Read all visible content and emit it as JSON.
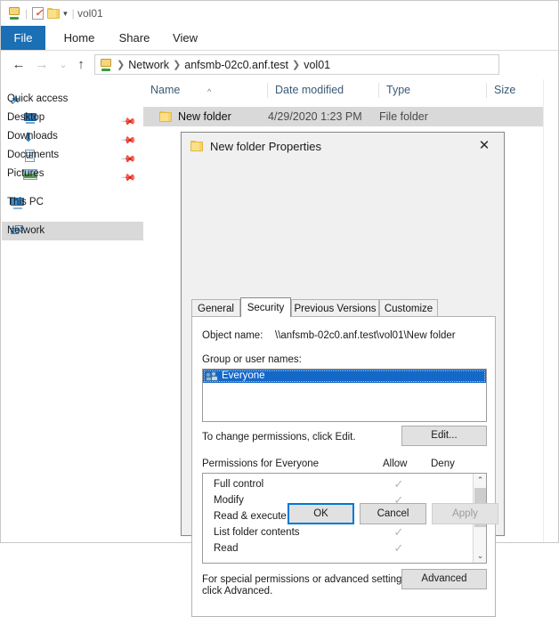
{
  "window": {
    "title": "vol01",
    "quick_access_toolbar": [
      {
        "name": "network-drive-icon",
        "glyph": "netdrive"
      },
      {
        "name": "properties-icon",
        "glyph": "props"
      },
      {
        "name": "new-folder-icon",
        "glyph": "folder"
      },
      {
        "name": "customize-qat-caret",
        "glyph": "caret"
      }
    ],
    "ribbon_tabs": [
      {
        "label": "File",
        "active": true
      },
      {
        "label": "Home",
        "active": false
      },
      {
        "label": "Share",
        "active": false
      },
      {
        "label": "View",
        "active": false
      }
    ],
    "nav_buttons": {
      "back": "←",
      "forward": "→",
      "recent": "⌄",
      "up": "↑"
    },
    "breadcrumb": [
      "Network",
      "anfsmb-02c0.anf.test",
      "vol01"
    ]
  },
  "sidebar": {
    "items": [
      {
        "label": "Quick access",
        "icon": "star-icon",
        "pinned": false,
        "selected": false,
        "root": true
      },
      {
        "label": "Desktop",
        "icon": "desktop-icon",
        "pinned": true,
        "selected": false,
        "root": false
      },
      {
        "label": "Downloads",
        "icon": "downloads-icon",
        "pinned": true,
        "selected": false,
        "root": false
      },
      {
        "label": "Documents",
        "icon": "documents-icon",
        "pinned": true,
        "selected": false,
        "root": false
      },
      {
        "label": "Pictures",
        "icon": "pictures-icon",
        "pinned": true,
        "selected": false,
        "root": false
      },
      {
        "label": "This PC",
        "icon": "this-pc-icon",
        "pinned": false,
        "selected": false,
        "root": true
      },
      {
        "label": "Network",
        "icon": "network-icon",
        "pinned": false,
        "selected": true,
        "root": true
      }
    ]
  },
  "file_list": {
    "columns": [
      {
        "label": "Name",
        "sorted": true,
        "sort_arrow": "^"
      },
      {
        "label": "Date modified",
        "sorted": false
      },
      {
        "label": "Type",
        "sorted": false
      },
      {
        "label": "Size",
        "sorted": false
      }
    ],
    "rows": [
      {
        "name": "New folder",
        "date_modified": "4/29/2020 1:23 PM",
        "type": "File folder",
        "size": "",
        "selected": true
      }
    ]
  },
  "dialog": {
    "title": "New folder Properties",
    "close_label": "✕",
    "tabs": [
      {
        "label": "General",
        "active": false
      },
      {
        "label": "Security",
        "active": true
      },
      {
        "label": "Previous Versions",
        "active": false
      },
      {
        "label": "Customize",
        "active": false
      }
    ],
    "object_name_label": "Object name:",
    "object_name_value": "\\\\anfsmb-02c0.anf.test\\vol01\\New folder",
    "group_label": "Group or user names:",
    "groups": [
      {
        "label": "Everyone",
        "selected": true
      }
    ],
    "change_hint": "To change permissions, click Edit.",
    "edit_button": "Edit...",
    "permissions_label": "Permissions for Everyone",
    "allow_header": "Allow",
    "deny_header": "Deny",
    "permissions": [
      {
        "name": "Full control",
        "allow": true,
        "deny": false
      },
      {
        "name": "Modify",
        "allow": true,
        "deny": false
      },
      {
        "name": "Read & execute",
        "allow": true,
        "deny": false
      },
      {
        "name": "List folder contents",
        "allow": true,
        "deny": false
      },
      {
        "name": "Read",
        "allow": true,
        "deny": false
      }
    ],
    "check_glyph": "✓",
    "advanced_hint_line1": "For special permissions or advanced settings,",
    "advanced_hint_line2": "click Advanced.",
    "advanced_button": "Advanced",
    "ok_button": "OK",
    "cancel_button": "Cancel",
    "apply_button": "Apply",
    "scroll_up_glyph": "⌃",
    "scroll_down_glyph": "⌄"
  },
  "colors": {
    "accent": "#1a6fb5",
    "selection": "#1468c8",
    "row_selection": "#d9d9d9",
    "focus_ring": "#0078d7",
    "column_header_text": "#3a5a78"
  }
}
